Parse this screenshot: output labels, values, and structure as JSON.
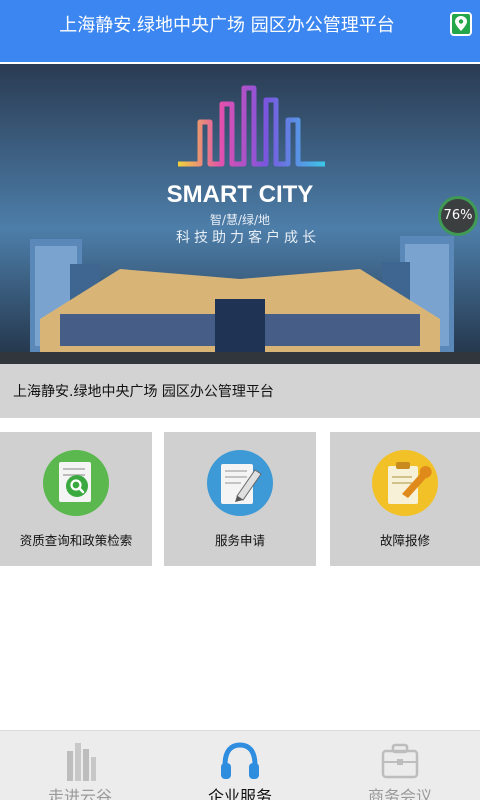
{
  "header": {
    "title": "上海静安.绿地中央广场 园区办公管理平台",
    "location_icon": "map-pin-icon"
  },
  "banner": {
    "logo_text": "SMART CITY",
    "sub_title": "智/慧/绿/地",
    "slogan": "科技助力客户成长",
    "progress_label": "76%"
  },
  "caption": "上海静安.绿地中央广场 园区办公管理平台",
  "services": [
    {
      "label": "资质查询和政策检索",
      "icon": "search-document-icon"
    },
    {
      "label": "服务申请",
      "icon": "pen-document-icon"
    },
    {
      "label": "故障报修",
      "icon": "wrench-clipboard-icon"
    }
  ],
  "tabs": [
    {
      "label": "走进云谷",
      "icon": "building-icon"
    },
    {
      "label": "企业服务",
      "icon": "headphones-icon"
    },
    {
      "label": "商务会议",
      "icon": "briefcase-icon"
    }
  ],
  "colors": {
    "header": "#3b86f0",
    "tile": "#d0d0d0",
    "caption": "#d3d3d3",
    "tabbar": "#ececec"
  }
}
